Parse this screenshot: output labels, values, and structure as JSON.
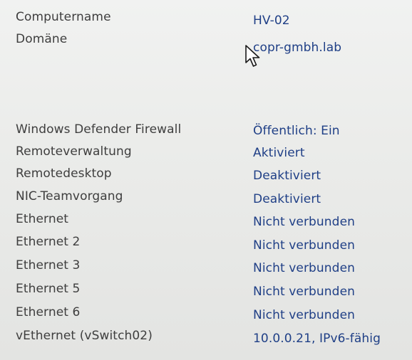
{
  "properties": [
    {
      "label": "Computername",
      "value": "HV-02"
    },
    {
      "label": "Domäne",
      "value": "copr-gmbh.lab"
    },
    {
      "label": "Windows Defender Firewall",
      "value": "Öffentlich: Ein"
    },
    {
      "label": "Remoteverwaltung",
      "value": "Aktiviert"
    },
    {
      "label": "Remotedesktop",
      "value": "Deaktiviert"
    },
    {
      "label": "NIC-Teamvorgang",
      "value": "Deaktiviert"
    },
    {
      "label": "Ethernet",
      "value": "Nicht verbunden"
    },
    {
      "label": "Ethernet 2",
      "value": "Nicht verbunden"
    },
    {
      "label": "Ethernet 3",
      "value": "Nicht verbunden"
    },
    {
      "label": "Ethernet 5",
      "value": "Nicht verbunden"
    },
    {
      "label": "Ethernet 6",
      "value": "Nicht verbunden"
    },
    {
      "label": "vEthernet (vSwitch02)",
      "value": "10.0.0.21, IPv6-fähig"
    }
  ],
  "colors": {
    "label": "#3e3e3e",
    "link": "#1f3f86",
    "background": "#ececeb"
  },
  "icons": {
    "pointer": "mouse-pointer-icon"
  }
}
